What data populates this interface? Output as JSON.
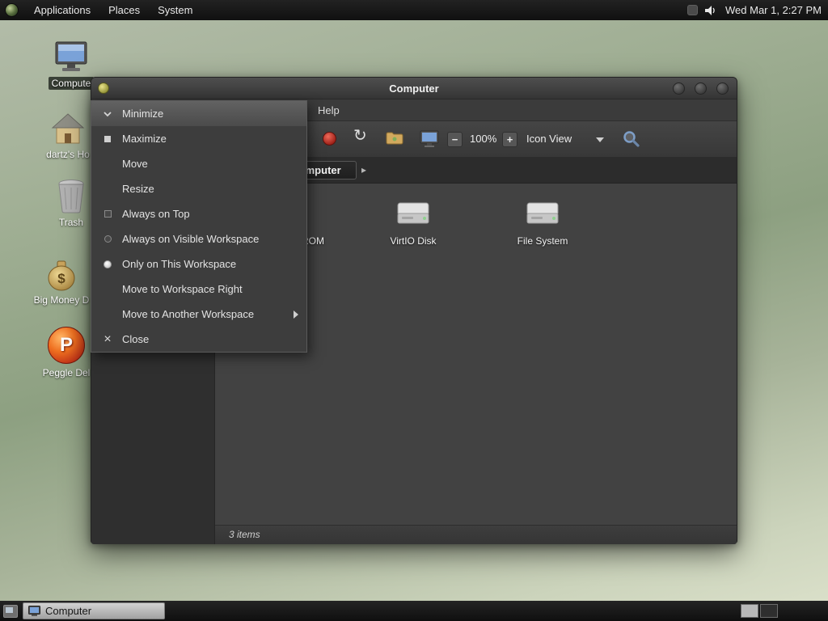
{
  "panel_top": {
    "menus": [
      {
        "label": "Applications"
      },
      {
        "label": "Places"
      },
      {
        "label": "System"
      }
    ],
    "clock": "Wed Mar 1, 2:27 PM"
  },
  "desktop_icons": [
    {
      "label": "Compute"
    },
    {
      "label": "dartz's Ho"
    },
    {
      "label": "Trash"
    },
    {
      "label": "Big Money D"
    },
    {
      "label": "Peggle Del"
    }
  ],
  "window": {
    "title": "Computer",
    "menubar_items": [
      {
        "label": "Help"
      }
    ],
    "toolbar": {
      "zoom_level": "100%",
      "view_mode": "Icon View"
    },
    "breadcrumb": {
      "label": "Computer",
      "arrow": "▸"
    },
    "files": [
      {
        "label": "ROM"
      },
      {
        "label": "VirtIO Disk"
      },
      {
        "label": "File System"
      }
    ],
    "status": "3 items"
  },
  "window_menu": {
    "items": [
      {
        "label": "Minimize"
      },
      {
        "label": "Maximize"
      },
      {
        "label": "Move"
      },
      {
        "label": "Resize"
      },
      {
        "label": "Always on Top"
      },
      {
        "label": "Always on Visible Workspace"
      },
      {
        "label": "Only on This Workspace"
      },
      {
        "label": "Move to Workspace Right"
      },
      {
        "label": "Move to Another Workspace"
      },
      {
        "label": "Close"
      }
    ]
  },
  "panel_bottom": {
    "tasks": [
      {
        "label": "Computer"
      }
    ]
  }
}
